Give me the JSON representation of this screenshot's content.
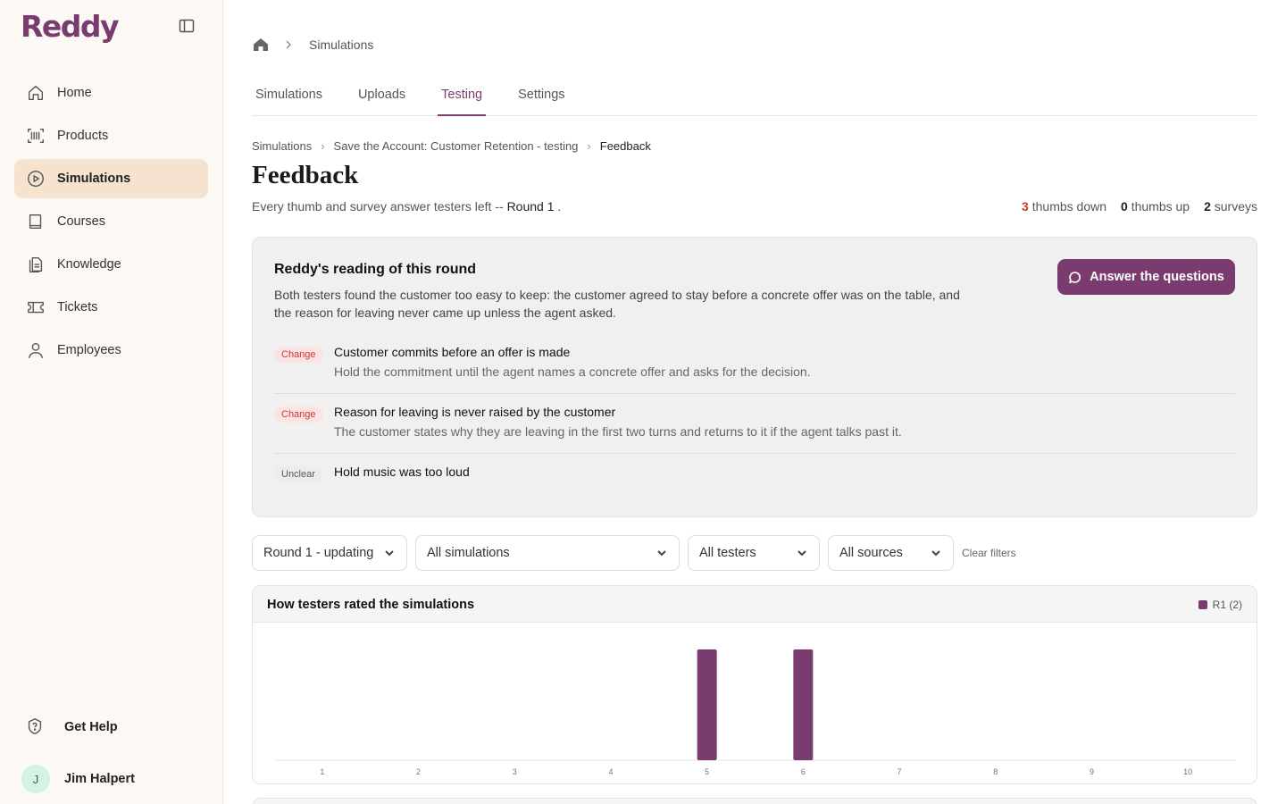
{
  "brand": "Reddy",
  "sidebar": {
    "items": [
      {
        "label": "Home",
        "icon": "home-icon"
      },
      {
        "label": "Products",
        "icon": "barcode-icon"
      },
      {
        "label": "Simulations",
        "icon": "play-circle-icon",
        "active": true
      },
      {
        "label": "Courses",
        "icon": "book-icon"
      },
      {
        "label": "Knowledge",
        "icon": "document-icon"
      },
      {
        "label": "Tickets",
        "icon": "ticket-icon"
      },
      {
        "label": "Employees",
        "icon": "user-icon"
      }
    ],
    "help_label": "Get Help",
    "user": {
      "initial": "J",
      "name": "Jim Halpert"
    }
  },
  "topcrumb": {
    "current": "Simulations"
  },
  "tabs": [
    "Simulations",
    "Uploads",
    "Testing",
    "Settings"
  ],
  "active_tab": "Testing",
  "breadcrumb": [
    "Simulations",
    "Save the Account: Customer Retention - testing",
    "Feedback"
  ],
  "page": {
    "title": "Feedback",
    "subtitle_prefix": "Every thumb and survey answer testers left -- ",
    "subtitle_round": "Round 1",
    "subtitle_suffix": " .",
    "stats": {
      "thumbs_down_count": "3",
      "thumbs_down_label": "thumbs down",
      "thumbs_up_count": "0",
      "thumbs_up_label": "thumbs up",
      "surveys_count": "2",
      "surveys_label": "surveys"
    }
  },
  "reading": {
    "title": "Reddy's reading of this round",
    "description": "Both testers found the customer too easy to keep: the customer agreed to stay before a concrete offer was on the table, and the reason for leaving never came up unless the agent asked.",
    "button_label": "Answer the questions",
    "items": [
      {
        "badge": "Change",
        "title": "Customer commits before an offer is made",
        "detail": "Hold the commitment until the agent names a concrete offer and asks for the decision."
      },
      {
        "badge": "Change",
        "title": "Reason for leaving is never raised by the customer",
        "detail": "The customer states why they are leaving in the first two turns and returns to it if the agent talks past it."
      },
      {
        "badge": "Unclear",
        "title": "Hold music was too loud",
        "detail": ""
      }
    ]
  },
  "filters": {
    "round": "Round 1 - updating",
    "simulations": "All simulations",
    "testers": "All testers",
    "sources": "All sources",
    "clear_label": "Clear filters"
  },
  "chart_data": {
    "type": "bar",
    "title": "How testers rated the simulations",
    "categories": [
      "1",
      "2",
      "3",
      "4",
      "5",
      "6",
      "7",
      "8",
      "9",
      "10"
    ],
    "series": [
      {
        "name": "R1 (2)",
        "values": [
          0,
          0,
          0,
          0,
          1,
          1,
          0,
          0,
          0,
          0
        ]
      }
    ],
    "color": "#7a3b6e",
    "ylim": [
      0,
      1
    ],
    "grid": false,
    "legend": "top-right"
  },
  "colors": {
    "accent": "#7a3b6e",
    "sidebar_bg": "#fcf8f3",
    "active_nav": "#f5e3d0",
    "danger": "#d0342c"
  }
}
